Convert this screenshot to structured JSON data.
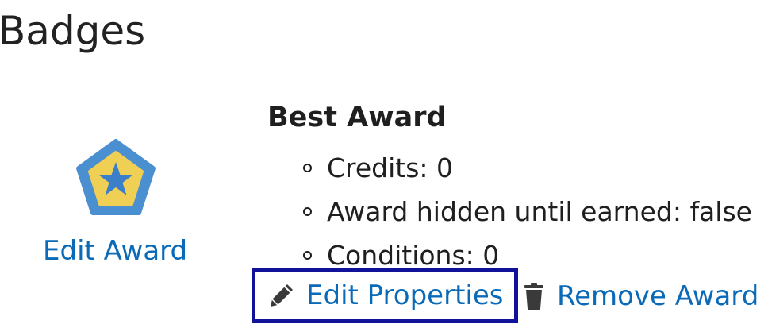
{
  "page": {
    "title": "Badges"
  },
  "badge": {
    "icon": "pentagon-star-badge-icon",
    "edit_award_label": "Edit Award",
    "name": "Best Award",
    "properties": [
      "Credits: 0",
      "Award hidden until earned: false",
      "Conditions: 0"
    ],
    "actions": {
      "edit_properties_label": "Edit Properties",
      "edit_properties_icon": "pencil-icon",
      "remove_award_label": "Remove Award",
      "remove_award_icon": "trash-icon"
    }
  },
  "colors": {
    "link": "#0a6ab8",
    "focus_outline": "#111199",
    "badge_outer": "#4a8fcf",
    "badge_inner": "#f0cf55",
    "badge_star": "#3a7fc8"
  }
}
